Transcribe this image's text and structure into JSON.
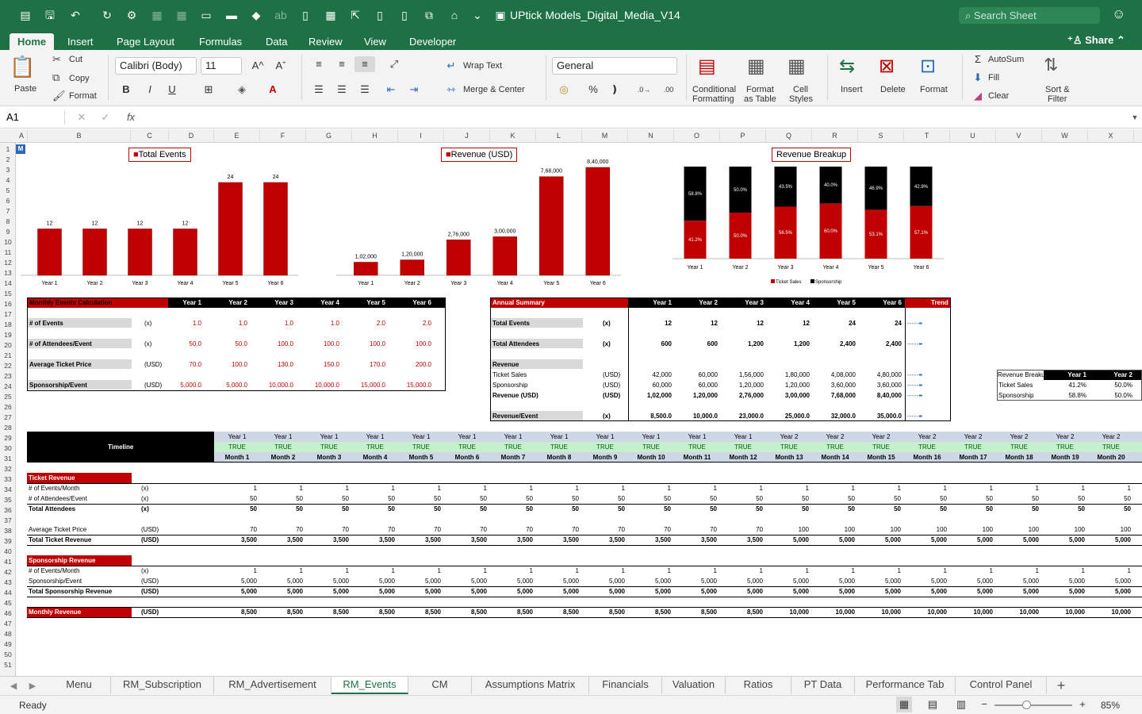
{
  "titlebar": {
    "doc": "UPtick Models_Digital_Media_V14",
    "search": "Search Sheet"
  },
  "tabs": [
    "Home",
    "Insert",
    "Page Layout",
    "Formulas",
    "Data",
    "Review",
    "View",
    "Developer"
  ],
  "share": "Share",
  "ribbon": {
    "paste": "Paste",
    "cut": "Cut",
    "copy": "Copy",
    "format": "Format",
    "font": "Calibri (Body)",
    "size": "11",
    "wrap": "Wrap Text",
    "merge": "Merge & Center",
    "numfmt": "General",
    "cond1": "Conditional",
    "cond2": "Formatting",
    "fat1": "Format",
    "fat2": "as Table",
    "cs1": "Cell",
    "cs2": "Styles",
    "insert": "Insert",
    "delete": "Delete",
    "formatc": "Format",
    "autosum": "AutoSum",
    "fill": "Fill",
    "clear": "Clear",
    "sort1": "Sort &",
    "sort2": "Filter",
    "bold": "B",
    "italic": "I",
    "underline": "U",
    "fx": "fx"
  },
  "namebox": "A1",
  "columns": [
    "A",
    "B",
    "C",
    "D",
    "E",
    "F",
    "G",
    "H",
    "I",
    "J",
    "K",
    "L",
    "M",
    "N",
    "O",
    "P",
    "Q",
    "R",
    "S",
    "T",
    "U",
    "V",
    "W",
    "X"
  ],
  "charts": {
    "events": {
      "title": "Total Events",
      "categories": [
        "Year 1",
        "Year 2",
        "Year 3",
        "Year 4",
        "Year 5",
        "Year 6"
      ],
      "values": [
        12,
        12,
        12,
        12,
        24,
        24
      ],
      "labels": [
        "12",
        "12",
        "12",
        "12",
        "24",
        "24"
      ]
    },
    "revenue": {
      "title": "Revenue (USD)",
      "categories": [
        "Year 1",
        "Year 2",
        "Year 3",
        "Year 4",
        "Year 5",
        "Year 6"
      ],
      "values": [
        102000,
        120000,
        276000,
        300000,
        768000,
        840000
      ],
      "labels": [
        "1,02,000",
        "1,20,000",
        "2,76,000",
        "3,00,000",
        "7,68,000",
        "8,40,000"
      ]
    },
    "breakup": {
      "title": "Revenue Breakup",
      "categories": [
        "Year 1",
        "Year 2",
        "Year 3",
        "Year 4",
        "Year 5",
        "Year 6"
      ],
      "ticket": [
        41.2,
        50.0,
        56.5,
        60.0,
        53.1,
        57.1
      ],
      "sponsor": [
        58.8,
        50.0,
        43.5,
        40.0,
        46.9,
        42.9
      ],
      "ticket_labels": [
        "41.2%",
        "50.0%",
        "56.5%",
        "60.0%",
        "53.1%",
        "57.1%"
      ],
      "sponsor_labels": [
        "58.8%",
        "50.0%",
        "43.5%",
        "40.0%",
        "46.9%",
        "42.9%"
      ],
      "legend": [
        "Ticket Sales",
        "Sponsorship"
      ]
    }
  },
  "monthly_calc": {
    "title": "Monthly Events Calculation",
    "years": [
      "Year 1",
      "Year 2",
      "Year 3",
      "Year 4",
      "Year 5",
      "Year 6"
    ],
    "rows": [
      {
        "label": "# of Events",
        "unit": "(x)",
        "vals": [
          "1.0",
          "1.0",
          "1.0",
          "1.0",
          "2.0",
          "2.0"
        ]
      },
      {
        "label": "# of Attendees/Event",
        "unit": "(x)",
        "vals": [
          "50.0",
          "50.0",
          "100.0",
          "100.0",
          "100.0",
          "100.0"
        ]
      },
      {
        "label": "Average Ticket Price",
        "unit": "(USD)",
        "vals": [
          "70.0",
          "100.0",
          "130.0",
          "150.0",
          "170.0",
          "200.0"
        ]
      },
      {
        "label": "Sponsorship/Event",
        "unit": "(USD)",
        "vals": [
          "5,000.0",
          "5,000.0",
          "10,000.0",
          "10,000.0",
          "15,000.0",
          "15,000.0"
        ]
      }
    ]
  },
  "annual": {
    "title": "Annual Summary",
    "years": [
      "Year 1",
      "Year 2",
      "Year 3",
      "Year 4",
      "Year 5",
      "Year 6"
    ],
    "trend": "Trend",
    "total_events": {
      "label": "Total Events",
      "unit": "(x)",
      "vals": [
        "12",
        "12",
        "12",
        "12",
        "24",
        "24"
      ]
    },
    "total_att": {
      "label": "Total Attendees",
      "unit": "(x)",
      "vals": [
        "600",
        "600",
        "1,200",
        "1,200",
        "2,400",
        "2,400"
      ]
    },
    "revenue": "Revenue",
    "ticket": {
      "label": "Ticket Sales",
      "unit": "(USD)",
      "vals": [
        "42,000",
        "60,000",
        "1,56,000",
        "1,80,000",
        "4,08,000",
        "4,80,000"
      ]
    },
    "sponsor": {
      "label": "Sponsorship",
      "unit": "(USD)",
      "vals": [
        "60,000",
        "60,000",
        "1,20,000",
        "1,20,000",
        "3,60,000",
        "3,60,000"
      ]
    },
    "rev": {
      "label": "Revenue (USD)",
      "unit": "(USD)",
      "vals": [
        "1,02,000",
        "1,20,000",
        "2,76,000",
        "3,00,000",
        "7,68,000",
        "8,40,000"
      ]
    },
    "rev_event": {
      "label": "Revenue/Event",
      "unit": "(x)",
      "vals": [
        "8,500.0",
        "10,000.0",
        "23,000.0",
        "25,000.0",
        "32,000.0",
        "35,000.0"
      ]
    }
  },
  "breakup_table": {
    "title": "Revenue Breakup",
    "y1": "Year 1",
    "y2": "Year 2",
    "rows": [
      {
        "label": "Ticket Sales",
        "v1": "41.2%",
        "v2": "50.0%"
      },
      {
        "label": "Sponsorship",
        "v1": "58.8%",
        "v2": "50.0%"
      }
    ]
  },
  "timeline": {
    "label": "Timeline",
    "years": [
      "Year 1",
      "Year 1",
      "Year 1",
      "Year 1",
      "Year 1",
      "Year 1",
      "Year 1",
      "Year 1",
      "Year 1",
      "Year 1",
      "Year 1",
      "Year 1",
      "Year 2",
      "Year 2",
      "Year 2",
      "Year 2",
      "Year 2",
      "Year 2",
      "Year 2",
      "Year 2"
    ],
    "flag": "TRUE",
    "months": [
      "Month 1",
      "Month 2",
      "Month 3",
      "Month 4",
      "Month 5",
      "Month 6",
      "Month 7",
      "Month 8",
      "Month 9",
      "Month 10",
      "Month 11",
      "Month 12",
      "Month 13",
      "Month 14",
      "Month 15",
      "Month 16",
      "Month 17",
      "Month 18",
      "Month 19",
      "Month 20"
    ]
  },
  "ticket_rev": {
    "title": "Ticket Revenue",
    "rows": [
      {
        "label": "# of Events/Month",
        "unit": "(x)",
        "y1": "1",
        "y2": "1",
        "bold": false
      },
      {
        "label": "# of Attendees/Event",
        "unit": "(x)",
        "y1": "50",
        "y2": "50",
        "bold": false
      },
      {
        "label": "Total Attendees",
        "unit": "(x)",
        "y1": "50",
        "y2": "50",
        "bold": true
      },
      {
        "label": "Average Ticket Price",
        "unit": "(USD)",
        "y1": "70",
        "y2": "100",
        "bold": false
      },
      {
        "label": "Total Ticket Revenue",
        "unit": "(USD)",
        "y1": "3,500",
        "y2": "5,000",
        "bold": true
      }
    ]
  },
  "spons_rev": {
    "title": "Sponsorship Revenue",
    "rows": [
      {
        "label": "# of Events/Month",
        "unit": "(x)",
        "y1": "1",
        "y2": "1",
        "bold": false
      },
      {
        "label": "Sponsorship/Event",
        "unit": "(USD)",
        "y1": "5,000",
        "y2": "5,000",
        "bold": false
      },
      {
        "label": "Total Sponsorship Revenue",
        "unit": "(USD)",
        "y1": "5,000",
        "y2": "5,000",
        "bold": true
      }
    ]
  },
  "monthly_rev": {
    "label": "Monthly Revenue",
    "unit": "(USD)",
    "y1": "8,500",
    "y2": "10,000"
  },
  "sheets": [
    "Menu",
    "RM_Subscription",
    "RM_Advertisement",
    "RM_Events",
    "CM",
    "Assumptions Matrix",
    "Financials",
    "Valuation",
    "Ratios",
    "PT Data",
    "Performance Tab",
    "Control Panel"
  ],
  "status": {
    "ready": "Ready",
    "zoom": "85%"
  }
}
